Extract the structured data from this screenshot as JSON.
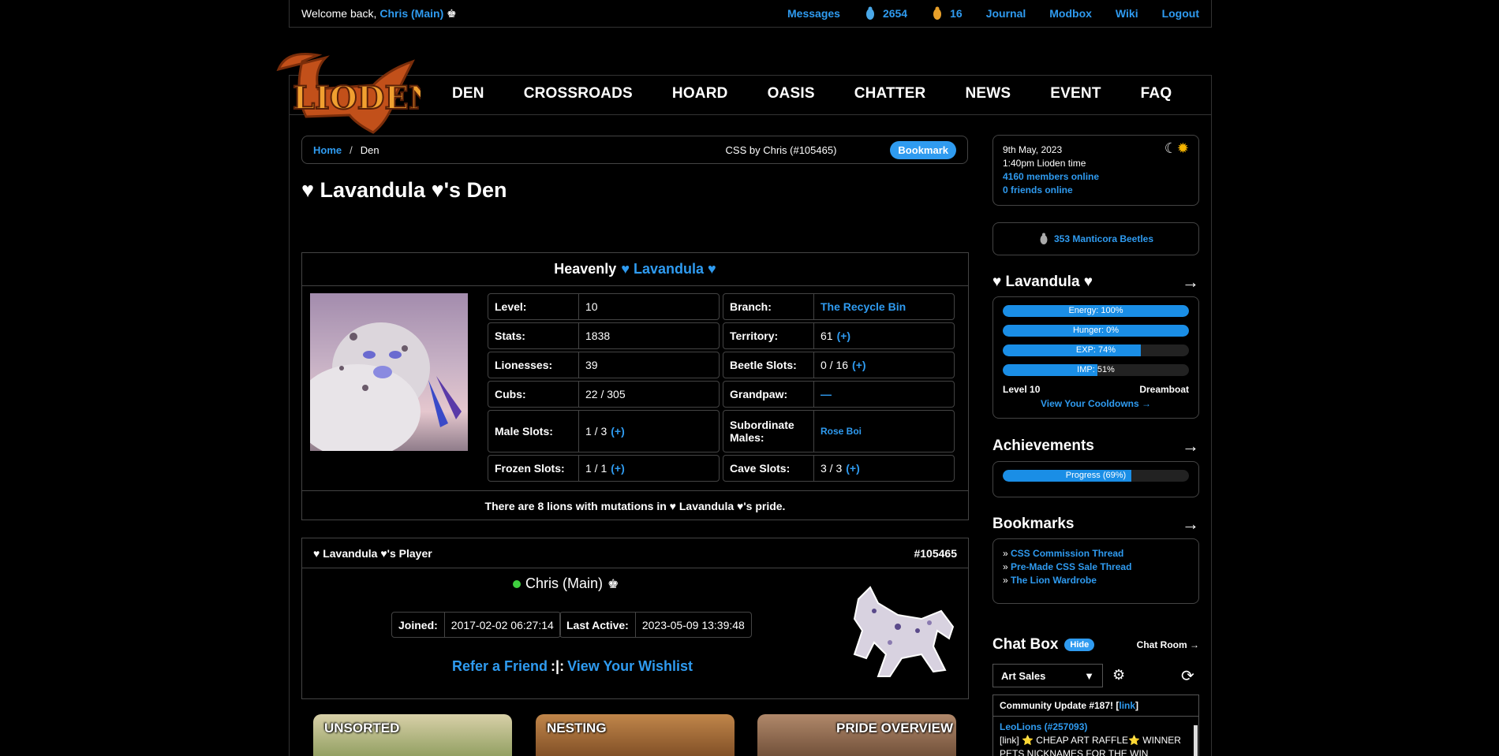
{
  "topbar": {
    "welcome": "Welcome back,",
    "user": "Chris (Main)",
    "messages": "Messages",
    "beetles": "2654",
    "scarabs": "16",
    "journal": "Journal",
    "modbox": "Modbox",
    "wiki": "Wiki",
    "logout": "Logout"
  },
  "logo_text": "LIODEN",
  "nav": [
    "DEN",
    "CROSSROADS",
    "HOARD",
    "OASIS",
    "CHATTER",
    "NEWS",
    "EVENT",
    "FAQ"
  ],
  "breadcrumb": {
    "home": "Home",
    "sep": "/",
    "current": "Den",
    "css_credit": "CSS by Chris (#105465)",
    "bookmark": "Bookmark"
  },
  "page_title": "♥ Lavandula ♥'s Den",
  "lion": {
    "prefix": "Heavenly",
    "name": "♥ Lavandula ♥",
    "stats_left": [
      {
        "k": "Level:",
        "v": "10",
        "plus": ""
      },
      {
        "k": "Stats:",
        "v": "1838",
        "plus": ""
      },
      {
        "k": "Lionesses:",
        "v": "39",
        "plus": ""
      },
      {
        "k": "Cubs:",
        "v": "22 / 305",
        "plus": ""
      },
      {
        "k": "Male Slots:",
        "v": "1 / 3",
        "plus": "(+)"
      },
      {
        "k": "Frozen Slots:",
        "v": "1 / 1",
        "plus": "(+)"
      }
    ],
    "stats_right": [
      {
        "k": "Branch:",
        "v": "The Recycle Bin",
        "plus": ""
      },
      {
        "k": "Territory:",
        "v": "61",
        "plus": "(+)"
      },
      {
        "k": "Beetle Slots:",
        "v": "0 / 16",
        "plus": "(+)"
      },
      {
        "k": "Grandpaw:",
        "v": "—",
        "plus": ""
      },
      {
        "k": "Subordinate Males:",
        "v": "Rose Boi",
        "plus": ""
      },
      {
        "k": "Cave Slots:",
        "v": "3 / 3",
        "plus": "(+)"
      }
    ],
    "mutation_text": "There are 8 lions with mutations in ♥ Lavandula ♥'s pride."
  },
  "player": {
    "header": "♥ Lavandula ♥'s Player",
    "id": "#105465",
    "name": "Chris (Main)",
    "joined_label": "Joined:",
    "joined": "2017-02-02 06:27:14",
    "active_label": "Last Active:",
    "active": "2023-05-09 13:39:48",
    "refer": "Refer a Friend",
    "divider": ":|:",
    "wishlist": "View Your Wishlist"
  },
  "tiles": [
    "UNSORTED",
    "NESTING",
    "PRIDE OVERVIEW"
  ],
  "sidebar": {
    "date": "9th May, 2023",
    "time": "1:40pm Lioden time",
    "members": "4160 members online",
    "friends": "0 friends online",
    "beetles": "353 Manticora Beetles",
    "lion_name": "♥ Lavandula ♥",
    "bars": [
      {
        "label": "Energy: 100%",
        "pct": 100
      },
      {
        "label": "Hunger: 0%",
        "pct": 100
      },
      {
        "label": "EXP: 74%",
        "pct": 74
      },
      {
        "label": "IMP: 51%",
        "pct": 51
      }
    ],
    "level": "Level 10",
    "title": "Dreamboat",
    "cooldowns": "View Your Cooldowns →",
    "achievements": "Achievements",
    "progress": {
      "label": "Progress (69%)",
      "pct": 69
    },
    "bookmarks_title": "Bookmarks",
    "bookmarks": [
      "CSS Commission Thread",
      "Pre-Made CSS Sale Thread",
      "The Lion Wardrobe"
    ],
    "chat_title": "Chat Box",
    "hide": "Hide",
    "chat_room": "Chat Room →",
    "channel": "Art Sales",
    "community_update": "Community Update #187! [",
    "community_link": "link",
    "community_end": "]",
    "chat_user": "LeoLions (#257093)",
    "chat_msg": "[link] ⭐ CHEAP ART RAFFLE⭐ WINNER",
    "chat_msg2": "PETS NICKNAMES FOR THE WIN"
  },
  "colors": {
    "accent": "#2f9bf0",
    "online": "#3fcf3f",
    "border": "#444"
  }
}
